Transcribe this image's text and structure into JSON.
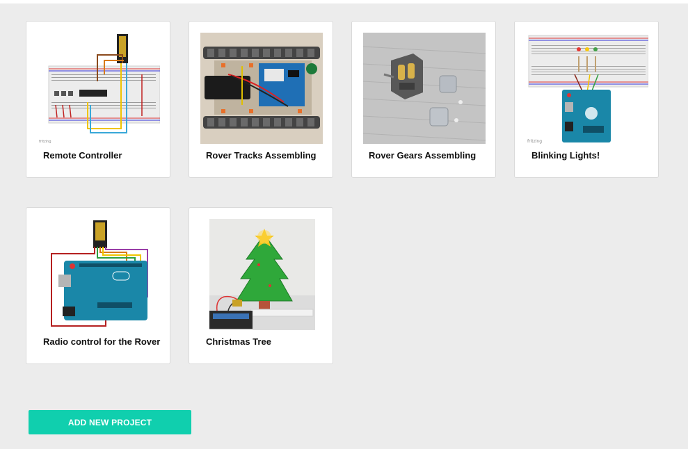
{
  "projects": [
    {
      "title": "Remote Controller",
      "image": "breadboard-circuit-diagram"
    },
    {
      "title": "Rover Tracks Assembling",
      "image": "rover-tracks-photo"
    },
    {
      "title": "Rover Gears Assembling",
      "image": "gearbox-photo"
    },
    {
      "title": "Blinking Lights!",
      "image": "arduino-leds-diagram",
      "thumb_caption": "fritzing"
    },
    {
      "title": "Radio control for the Rover",
      "image": "arduino-radio-diagram"
    },
    {
      "title": "Christmas Tree",
      "image": "christmas-tree-photo"
    }
  ],
  "actions": {
    "add_project_label": "ADD NEW PROJECT"
  },
  "colors": {
    "accent": "#10cfae",
    "background": "#ececec",
    "card": "#ffffff"
  }
}
